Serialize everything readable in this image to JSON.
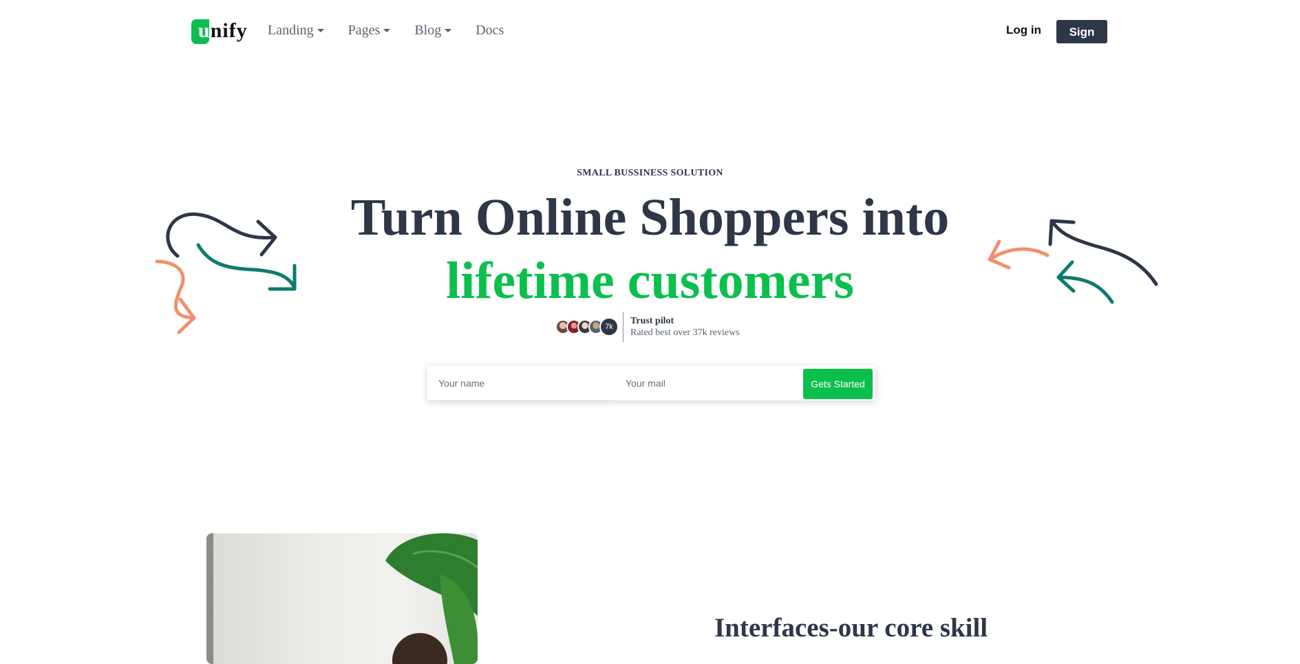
{
  "brand": {
    "logo_text": "unify",
    "accent_color": "#0bbf4d",
    "dark_color": "#2d3748",
    "orange_color": "#f0906a",
    "teal_color": "#0f7a6e"
  },
  "nav": {
    "items": [
      {
        "label": "Landing",
        "has_dropdown": true
      },
      {
        "label": "Pages",
        "has_dropdown": true
      },
      {
        "label": "Blog",
        "has_dropdown": true
      },
      {
        "label": "Docs",
        "has_dropdown": false
      }
    ],
    "login_label": "Log in",
    "signup_label": "Sign up"
  },
  "hero": {
    "eyebrow": "SMALL BUSSINESS SOLUTION",
    "headline_line1": "Turn Online Shoppers into",
    "headline_line2": "lifetime customers",
    "trust": {
      "avatar_count_label": "7k",
      "title": "Trust pilot",
      "subtitle": "Rated best over 37k reviews"
    },
    "form": {
      "name_placeholder": "Your name",
      "mail_placeholder": "Your mail",
      "cta_label": "Gets Started"
    }
  },
  "feature": {
    "title": "Interfaces-our core skill"
  }
}
